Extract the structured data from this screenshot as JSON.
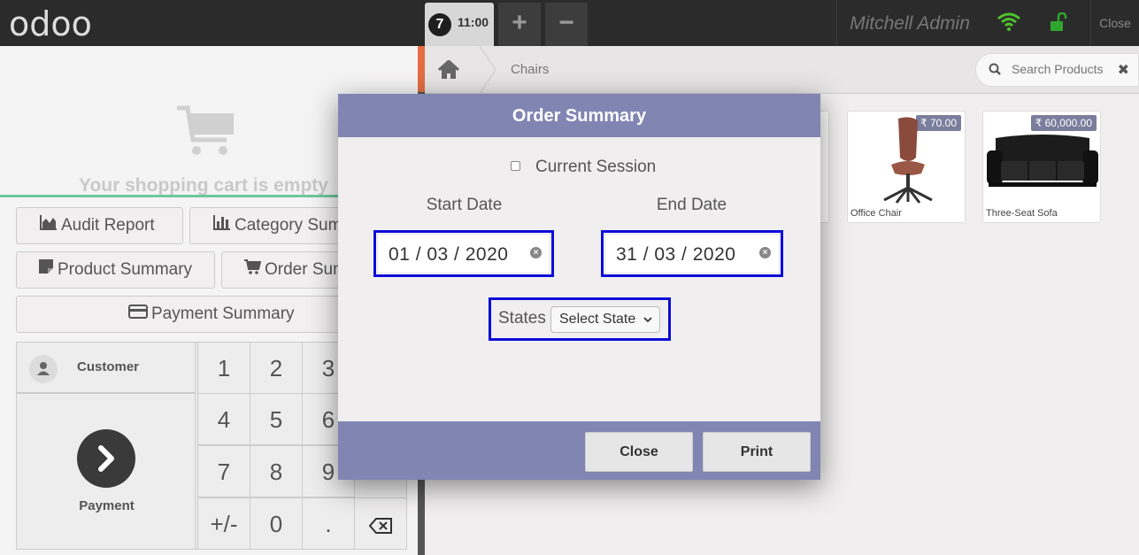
{
  "topbar": {
    "logo": "odoo",
    "order_number": "7",
    "order_time": "11:00",
    "add_label": "+",
    "remove_label": "−",
    "user": "Mitchell Admin",
    "close_label": "Close"
  },
  "left": {
    "empty_cart": "Your shopping cart is empty",
    "buttons": {
      "audit_report": "Audit Report",
      "category_summary": "Category Sum",
      "product_summary": "Product Summary",
      "order_summary": "Order Sum",
      "payment_summary": "Payment Summary"
    },
    "customer": "Customer",
    "payment": "Payment",
    "keys": [
      "1",
      "2",
      "3",
      "4",
      "5",
      "6",
      "7",
      "8",
      "9",
      "+/-",
      "0",
      "."
    ]
  },
  "right": {
    "breadcrumb": "Chairs",
    "search_placeholder": "Search Products",
    "search_clear": "✖",
    "products": [
      {
        "name": "Office Chair",
        "price": "₹ 70.00"
      },
      {
        "name": "Three-Seat Sofa",
        "price": "₹ 60,000.00"
      }
    ]
  },
  "modal": {
    "title": "Order Summary",
    "current_session_label": "Current Session",
    "current_session_checked": false,
    "start_date_label": "Start Date",
    "end_date_label": "End Date",
    "start_date": "01 / 03 / 2020",
    "end_date": "31 / 03 / 2020",
    "states_label": "States",
    "state_select": "Select State",
    "close_button": "Close",
    "print_button": "Print"
  },
  "colors": {
    "modal_header": "#8185b2",
    "highlight_border": "#0b0bd9",
    "wifi": "#4ec22c",
    "lock": "#2ea62e"
  }
}
